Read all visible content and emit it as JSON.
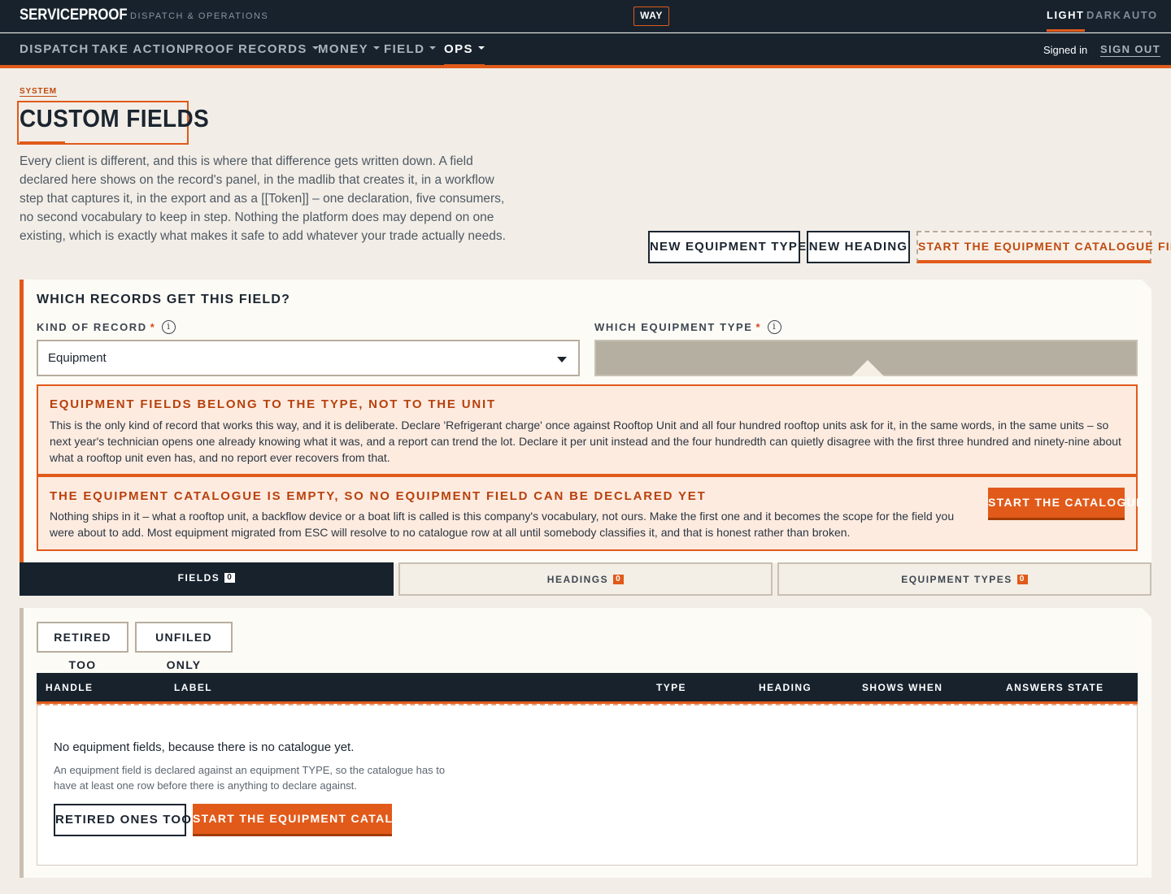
{
  "app": {
    "brand": "SERVICEPROOF",
    "subtitle": "DISPATCH & OPERATIONS",
    "way_badge": "WAY",
    "themes": [
      "LIGHT",
      "DARK",
      "AUTO"
    ],
    "active_theme": "LIGHT"
  },
  "nav": {
    "items": [
      "DISPATCH",
      "TAKE ACTION",
      "PROOF",
      "RECORDS",
      "MONEY",
      "FIELD",
      "OPS"
    ],
    "active": "OPS",
    "signed_in": "Signed in",
    "sign_out": "SIGN OUT"
  },
  "page": {
    "breadcrumb": "SYSTEM",
    "title": "CUSTOM FIELDS",
    "lead": "Every client is different, and this is where that difference gets written down. A field declared here shows on the record's panel, in the madlib that creates it, in a workflow step that captures it, in the export and as a [[Token]] – one declaration, five consumers, no second vocabulary to keep in step. Nothing the platform does may depend on one existing, which is exactly what makes it safe to add whatever your trade actually needs.",
    "actions": {
      "new_equipment_type": "NEW EQUIPMENT TYPE",
      "new_heading": "NEW HEADING",
      "start_catalogue_first": "START THE EQUIPMENT CATALOGUE FIRST"
    }
  },
  "scope": {
    "heading": "WHICH RECORDS GET THIS FIELD?",
    "kind_label": "KIND OF RECORD",
    "kind_value": "Equipment",
    "equip_type_label": "WHICH EQUIPMENT TYPE",
    "required_mark": "*",
    "info_glyph": "i",
    "notice1": {
      "title": "EQUIPMENT FIELDS BELONG TO THE TYPE, NOT TO THE UNIT",
      "body": "This is the only kind of record that works this way, and it is deliberate. Declare 'Refrigerant charge' once against Rooftop Unit and all four hundred rooftop units ask for it, in the same words, in the same units – so next year's technician opens one already knowing what it was, and a report can trend the lot. Declare it per unit instead and the four hundredth can quietly disagree with the first three hundred and ninety-nine about what a rooftop unit even has, and no report ever recovers from that."
    },
    "notice2": {
      "title": "THE EQUIPMENT CATALOGUE IS EMPTY, SO NO EQUIPMENT FIELD CAN BE DECLARED YET",
      "body": "Nothing ships in it – what a rooftop unit, a backflow device or a boat lift is called is this company's vocabulary, not ours. Make the first one and it becomes the scope for the field you were about to add. Most equipment migrated from ESC will resolve to no catalogue row at all until somebody classifies it, and that is honest rather than broken.",
      "button": "START THE CATALOGUE"
    }
  },
  "tabs": [
    {
      "label": "FIELDS",
      "count": "0"
    },
    {
      "label": "HEADINGS",
      "count": "0"
    },
    {
      "label": "EQUIPMENT TYPES",
      "count": "0"
    }
  ],
  "list": {
    "filters": [
      "RETIRED TOO",
      "UNFILED ONLY"
    ],
    "columns": [
      "HANDLE",
      "LABEL",
      "TYPE",
      "HEADING",
      "SHOWS WHEN",
      "ANSWERS",
      "STATE"
    ],
    "empty_title": "No equipment fields, because there is no catalogue yet.",
    "empty_body": "An equipment field is declared against an equipment TYPE, so the catalogue has to have at least one row before there is anything to declare against.",
    "retired_button": "RETIRED ONES TOO",
    "start_button": "START THE EQUIPMENT CATALOGUE"
  },
  "colors": {
    "accent": "#e15a1a",
    "navy": "#17222d",
    "page_bg": "#f2eee7"
  }
}
